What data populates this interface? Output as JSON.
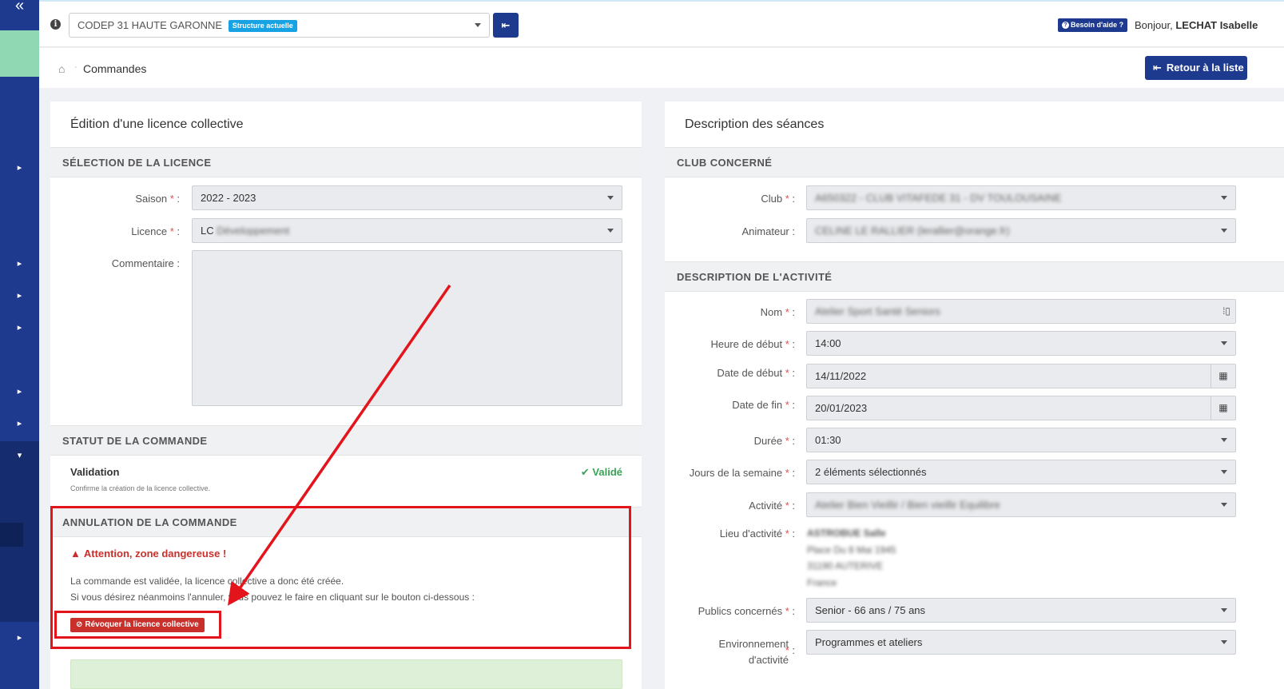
{
  "sidebar": {
    "collapse_glyph": "«",
    "arrow_glyph": "▸",
    "open_glyph": "▾"
  },
  "topbar": {
    "structure_name": "CODEP 31 HAUTE GARONNE",
    "structure_badge": "Structure actuelle",
    "help_label": "Besoin d'aide ?",
    "greeting_prefix": "Bonjour, ",
    "user_name": "LECHAT Isabelle"
  },
  "breadcrumb": {
    "current": "Commandes",
    "back_label": "Retour à la liste"
  },
  "left_panel": {
    "title": "Édition d'une licence collective",
    "selection_section": "SÉLECTION DE LA LICENCE",
    "saison_label": "Saison",
    "saison_value": "2022 - 2023",
    "licence_label": "Licence",
    "licence_value_prefix": "LC ",
    "licence_value_blur": "Développement",
    "comment_label": "Commentaire :",
    "status_section": "STATUT DE LA COMMANDE",
    "validation_title": "Validation",
    "validation_subtitle": "Confirme la création de la licence collective.",
    "validation_status": "Validé",
    "cancel_section": "ANNULATION DE LA COMMANDE",
    "danger_title": "Attention, zone dangereuse !",
    "danger_line1": "La commande est validée, la licence collective a donc été créée.",
    "danger_line2": "Si vous désirez néanmoins l'annuler, vous pouvez le faire en cliquant sur le bouton ci-dessous :",
    "revoke_label": "Révoquer la licence collective"
  },
  "right_panel": {
    "title": "Description des séances",
    "club_section": "CLUB CONCERNÉ",
    "club_label": "Club",
    "club_value": "A650322 - CLUB VITAFEDE 31 - DV TOULOUSAINE",
    "animateur_label": "Animateur :",
    "animateur_value": "CELINE LE RALLIER (lerallier@orange.fr)",
    "activity_section": "DESCRIPTION DE L'ACTIVITÉ",
    "nom_label": "Nom",
    "nom_value": "Atelier Sport Santé Seniors",
    "heure_label": "Heure de début",
    "heure_value": "14:00",
    "date_debut_label": "Date de début",
    "date_debut_value": "14/11/2022",
    "date_fin_label": "Date de fin",
    "date_fin_value": "20/01/2023",
    "duree_label": "Durée",
    "duree_value": "01:30",
    "jours_label": "Jours de la semaine",
    "jours_value": "2 éléments sélectionnés",
    "activite_label": "Activité",
    "activite_value": "Atelier Bien Vieillir / Bien vieillir Equilibre",
    "lieu_label": "Lieu d'activité",
    "lieu_lines": [
      "ASTROBUE Salle",
      "Place Du 8 Mai 1945",
      "31190 AUTERIVE",
      "France"
    ],
    "publics_label": "Publics concernés",
    "publics_value": "Senior - 66 ans / 75 ans",
    "env_label_1": "Environnement",
    "env_label_2": "d'activité",
    "env_value": "Programmes et ateliers"
  },
  "colors": {
    "sidebar": "#1d3a8f",
    "primary": "#1d3a8f",
    "danger": "#c9302c",
    "annotation_red": "#e3141b",
    "success": "#3aa357",
    "badge_blue": "#17a2e3"
  },
  "icons": {
    "info": "i",
    "swap": "⇤",
    "home": "⌂",
    "back": "⇤",
    "check": "✔",
    "warning": "▲",
    "ban": "⊘",
    "calendar": "▦",
    "question": "?"
  }
}
